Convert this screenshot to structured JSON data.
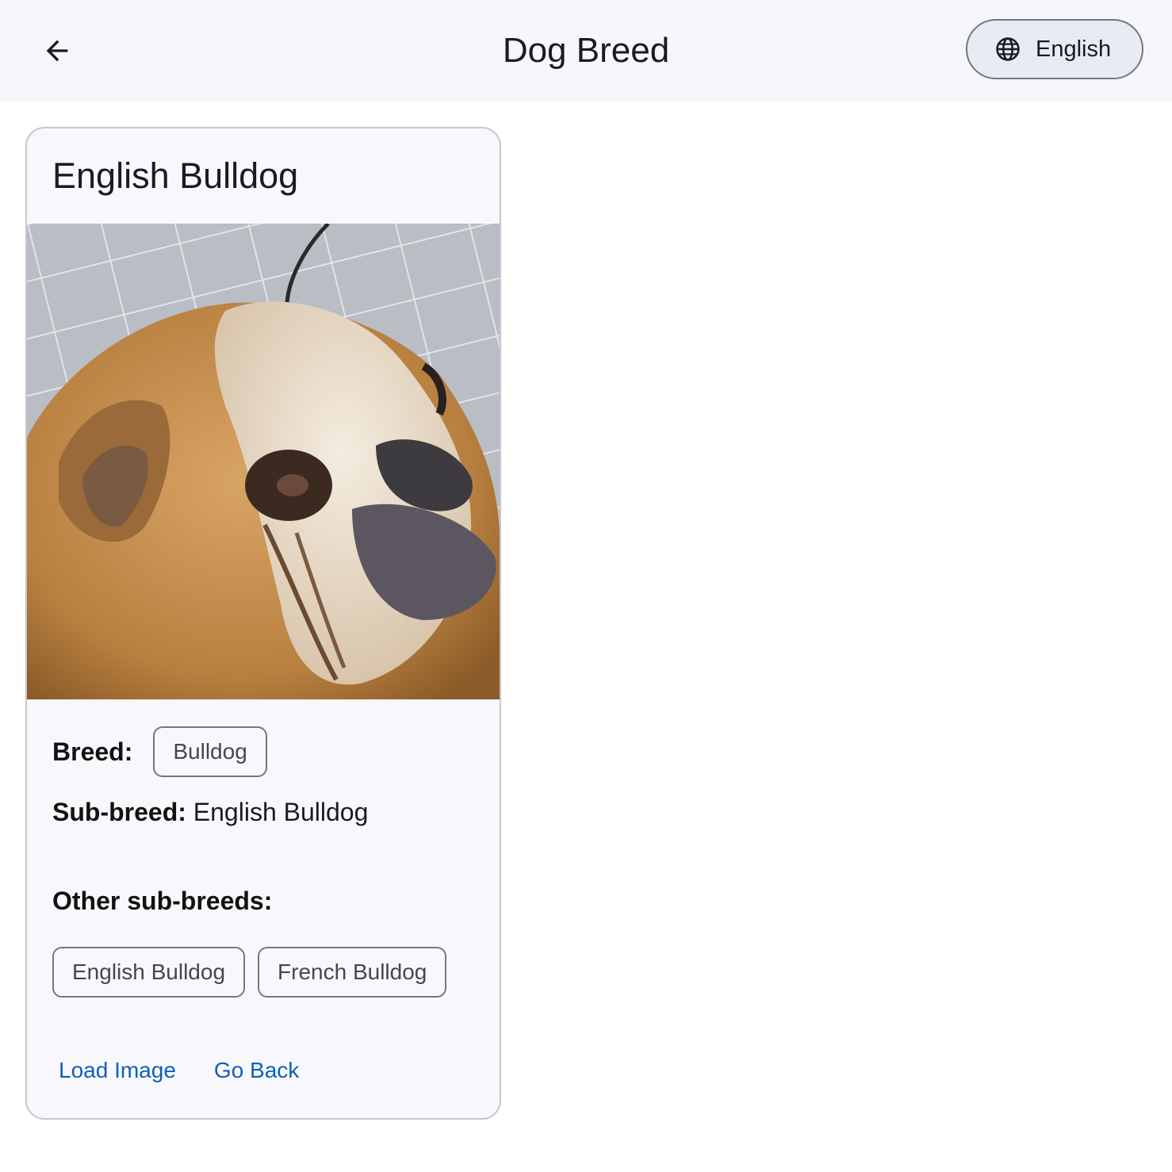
{
  "appbar": {
    "title": "Dog Breed",
    "back_icon": "arrow-left-icon",
    "language_icon": "globe-icon",
    "language_label": "English"
  },
  "card": {
    "title": "English Bulldog",
    "image_alt": "bulldog-photo",
    "breed_label": "Breed:",
    "breed_chip": "Bulldog",
    "subbreed_label": "Sub-breed:",
    "subbreed_value": " English Bulldog",
    "other_label": "Other sub-breeds:",
    "other_subbreeds": [
      "English Bulldog",
      "French Bulldog"
    ],
    "actions": {
      "load_image": "Load Image",
      "go_back": "Go Back"
    }
  },
  "colors": {
    "appbar_bg": "#f7f7fb",
    "language_button_bg": "#e6ebf4",
    "card_bg": "#f8f8fc",
    "accent": "#1160b8"
  }
}
